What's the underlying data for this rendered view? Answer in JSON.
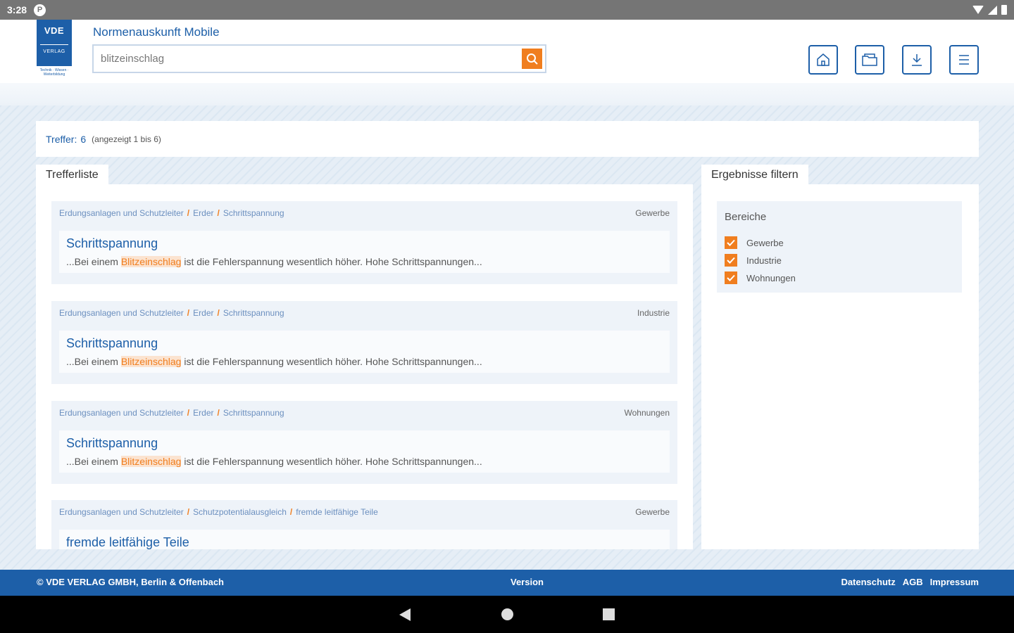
{
  "status_bar": {
    "time": "3:28",
    "app_badge": "P"
  },
  "header": {
    "logo": {
      "brand": "VDE",
      "sub": "VERLAG",
      "tagline": "Technik · Wissen · Weiterbildung"
    },
    "app_title": "Normenauskunft Mobile",
    "search": {
      "value": "blitzeinschlag",
      "placeholder": ""
    },
    "icons": [
      "home-icon",
      "folder-icon",
      "download-icon",
      "menu-icon"
    ]
  },
  "hits": {
    "label": "Treffer:",
    "count": "6",
    "shown": "(angezeigt 1 bis 6)"
  },
  "list": {
    "tab_label": "Trefferliste",
    "results": [
      {
        "crumb1": "Erdungsanlagen und Schutzleiter",
        "crumb2": "Erder",
        "crumb3": "Schrittspannung",
        "area": "Gewerbe",
        "title": "Schrittspannung",
        "pre": "...Bei einem ",
        "highlight": "Blitzeinschlag",
        "post": " ist die Fehlerspannung wesentlich höher. Hohe Schrittspannungen..."
      },
      {
        "crumb1": "Erdungsanlagen und Schutzleiter",
        "crumb2": "Erder",
        "crumb3": "Schrittspannung",
        "area": "Industrie",
        "title": "Schrittspannung",
        "pre": "...Bei einem ",
        "highlight": "Blitzeinschlag",
        "post": " ist die Fehlerspannung wesentlich höher. Hohe Schrittspannungen..."
      },
      {
        "crumb1": "Erdungsanlagen und Schutzleiter",
        "crumb2": "Erder",
        "crumb3": "Schrittspannung",
        "area": "Wohnungen",
        "title": "Schrittspannung",
        "pre": "...Bei einem ",
        "highlight": "Blitzeinschlag",
        "post": " ist die Fehlerspannung wesentlich höher. Hohe Schrittspannungen..."
      },
      {
        "crumb1": "Erdungsanlagen und Schutzleiter",
        "crumb2": "Schutzpotentialausgleich",
        "crumb3": "fremde leitfähige Teile",
        "area": "Gewerbe",
        "title": "fremde leitfähige Teile",
        "pre": "",
        "highlight": "",
        "post": ""
      }
    ]
  },
  "filter": {
    "tab_label": "Ergebnisse filtern",
    "section_title": "Bereiche",
    "options": [
      {
        "label": "Gewerbe",
        "checked": true
      },
      {
        "label": "Industrie",
        "checked": true
      },
      {
        "label": "Wohnungen",
        "checked": true
      }
    ]
  },
  "footer": {
    "copyright": "© VDE VERLAG GMBH, Berlin & Offenbach",
    "version": "Version",
    "links": [
      "Datenschutz",
      "AGB",
      "Impressum"
    ]
  },
  "colors": {
    "brand_blue": "#1d5fa8",
    "accent_orange": "#f07e1f"
  }
}
